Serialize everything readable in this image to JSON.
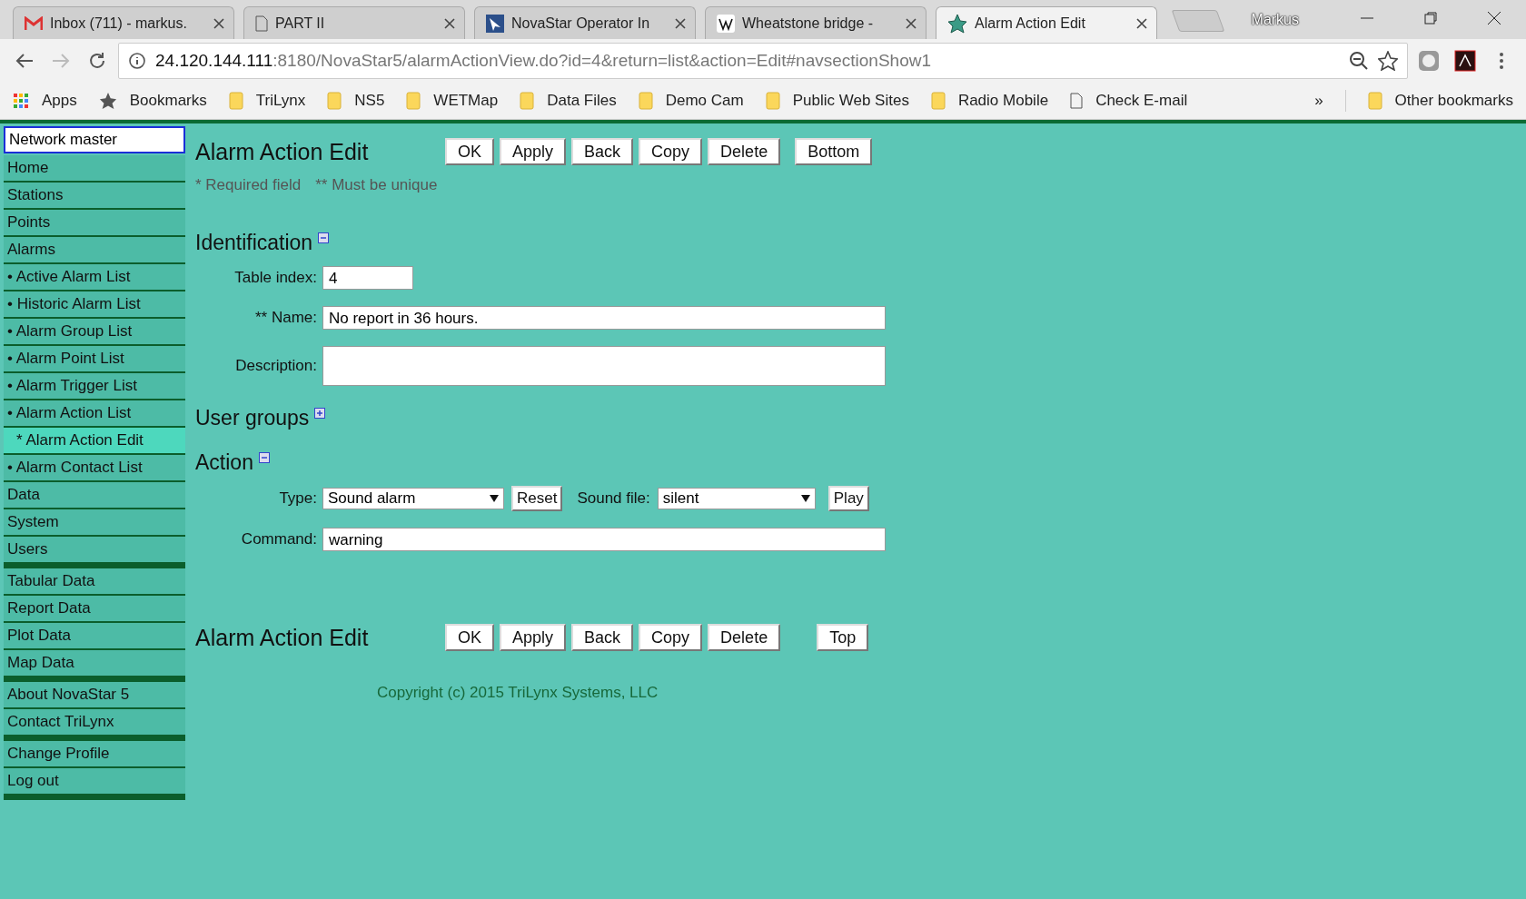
{
  "browser": {
    "tabs": [
      {
        "title": "Inbox (711) - markus.",
        "kind": "mail",
        "selected": false
      },
      {
        "title": "PART II",
        "kind": "page",
        "selected": false
      },
      {
        "title": "NovaStar Operator In",
        "kind": "app",
        "selected": false
      },
      {
        "title": "Wheatstone bridge -",
        "kind": "wiki",
        "selected": false
      },
      {
        "title": "Alarm Action Edit",
        "kind": "star",
        "selected": true
      }
    ],
    "profile": "Markus",
    "address": {
      "host": "24.120.144.111",
      "path": ":8180/NovaStar5/alarmActionView.do?id=4&return=list&action=Edit#navsectionShow1"
    },
    "bookmarks": [
      {
        "label": "Apps",
        "kind": "apps"
      },
      {
        "label": "Bookmarks",
        "kind": "star"
      },
      {
        "label": "TriLynx",
        "kind": "folder"
      },
      {
        "label": "NS5",
        "kind": "folder"
      },
      {
        "label": "WETMap",
        "kind": "folder"
      },
      {
        "label": "Data Files",
        "kind": "folder"
      },
      {
        "label": "Demo Cam",
        "kind": "folder"
      },
      {
        "label": "Public Web Sites",
        "kind": "folder"
      },
      {
        "label": "Radio Mobile",
        "kind": "folder"
      },
      {
        "label": "Check E-mail",
        "kind": "page"
      }
    ],
    "overflow": "»",
    "other_bookmarks": "Other bookmarks"
  },
  "sidebar": {
    "network": "Network master",
    "groups": [
      [
        {
          "label": "Home",
          "selected": false
        },
        {
          "label": "Stations",
          "selected": false
        },
        {
          "label": "Points",
          "selected": false
        },
        {
          "label": "Alarms",
          "selected": false
        },
        {
          "label": "• Active Alarm List",
          "selected": false
        },
        {
          "label": "• Historic Alarm List",
          "selected": false
        },
        {
          "label": "• Alarm Group List",
          "selected": false
        },
        {
          "label": "• Alarm Point List",
          "selected": false
        },
        {
          "label": "• Alarm Trigger List",
          "selected": false
        },
        {
          "label": "• Alarm Action List",
          "selected": false
        },
        {
          "label": "* Alarm Action Edit",
          "selected": true
        },
        {
          "label": "• Alarm Contact List",
          "selected": false
        },
        {
          "label": "Data",
          "selected": false
        },
        {
          "label": "System",
          "selected": false
        },
        {
          "label": "Users",
          "selected": false
        }
      ],
      [
        {
          "label": "Tabular Data",
          "selected": false
        },
        {
          "label": "Report Data",
          "selected": false
        },
        {
          "label": "Plot Data",
          "selected": false
        },
        {
          "label": "Map Data",
          "selected": false
        }
      ],
      [
        {
          "label": "About NovaStar 5",
          "selected": false
        },
        {
          "label": "Contact TriLynx",
          "selected": false
        }
      ],
      [
        {
          "label": "Change Profile",
          "selected": false
        },
        {
          "label": "Log out",
          "selected": false
        }
      ]
    ]
  },
  "header": {
    "title": "Alarm Action Edit",
    "buttons": [
      "OK",
      "Apply",
      "Back",
      "Copy",
      "Delete"
    ],
    "jump": "Bottom"
  },
  "notes": [
    "* Required field",
    "** Must be unique"
  ],
  "sections": [
    {
      "title": "Identification",
      "expanded": true,
      "rows": [
        {
          "label": "Table index:",
          "kind": "short",
          "value": "4"
        },
        {
          "label": "** Name:",
          "kind": "text",
          "value": "No report in 36 hours."
        },
        {
          "label": "Description:",
          "kind": "area",
          "value": ""
        }
      ]
    },
    {
      "title": "User groups",
      "expanded": false
    },
    {
      "title": "Action",
      "expanded": true,
      "rows": [
        {
          "label": "Type:",
          "kind": "select",
          "value": "Sound alarm",
          "button": "Reset",
          "label2": "Sound file:",
          "value2": "silent",
          "button2": "Play"
        },
        {
          "label": "Command:",
          "kind": "text",
          "value": "warning"
        }
      ]
    }
  ],
  "footer": {
    "title": "Alarm Action Edit",
    "buttons": [
      "OK",
      "Apply",
      "Back",
      "Copy",
      "Delete"
    ],
    "jump": "Top"
  },
  "copyright": "Copyright (c) 2015 TriLynx Systems, LLC"
}
